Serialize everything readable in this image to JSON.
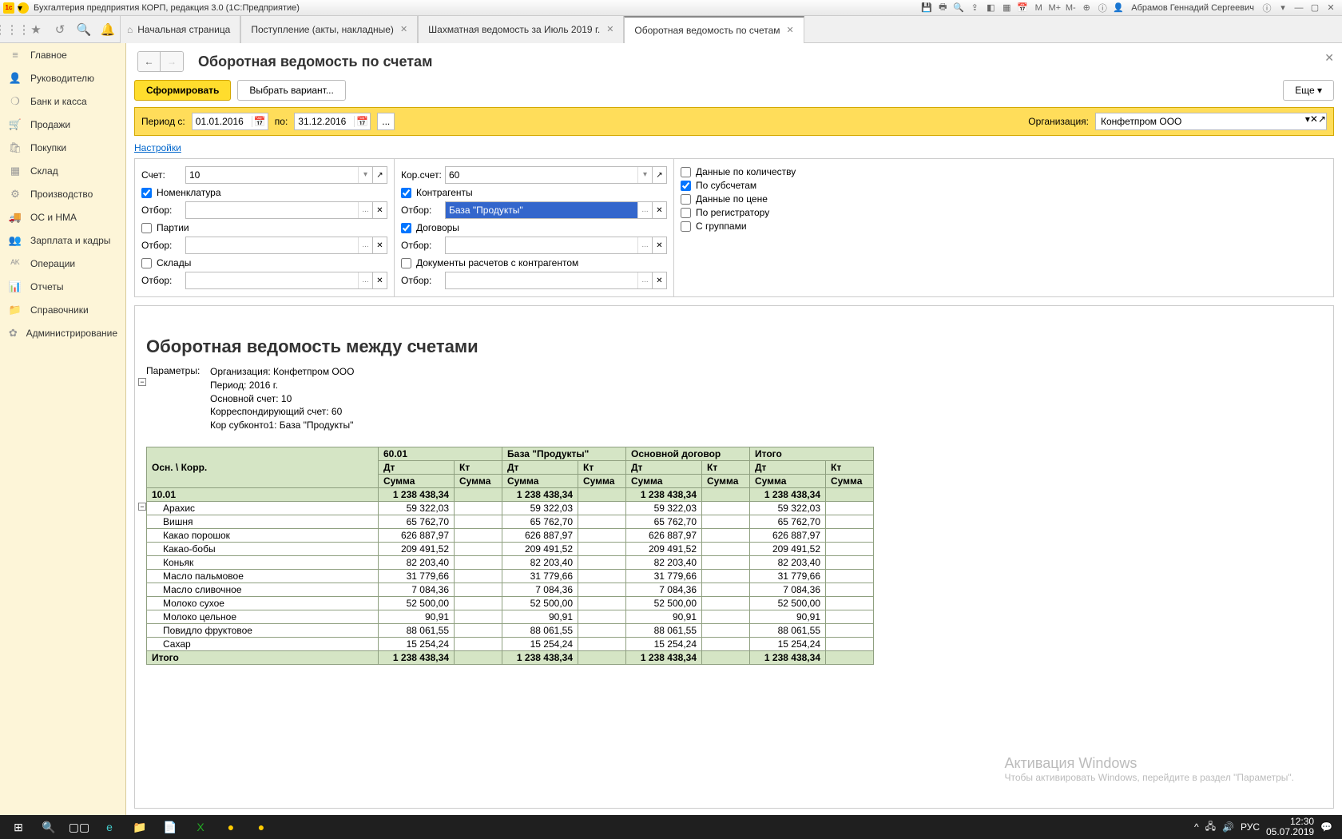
{
  "window": {
    "title": "Бухгалтерия предприятия КОРП, редакция 3.0  (1С:Предприятие)",
    "user": "Абрамов Геннадий Сергеевич"
  },
  "tabs": [
    {
      "label": "Начальная страница"
    },
    {
      "label": "Поступление (акты, накладные)"
    },
    {
      "label": "Шахматная ведомость за Июль 2019 г."
    },
    {
      "label": "Оборотная ведомость по счетам",
      "active": true
    }
  ],
  "sidebar": [
    {
      "icon": "≡",
      "label": "Главное"
    },
    {
      "icon": "👤",
      "label": "Руководителю"
    },
    {
      "icon": "❍",
      "label": "Банк и касса"
    },
    {
      "icon": "🛒",
      "label": "Продажи"
    },
    {
      "icon": "🛍",
      "label": "Покупки"
    },
    {
      "icon": "▦",
      "label": "Склад"
    },
    {
      "icon": "⚙",
      "label": "Производство"
    },
    {
      "icon": "🚚",
      "label": "ОС и НМА"
    },
    {
      "icon": "👥",
      "label": "Зарплата и кадры"
    },
    {
      "icon": "ᴬᴷ",
      "label": "Операции"
    },
    {
      "icon": "📊",
      "label": "Отчеты"
    },
    {
      "icon": "📁",
      "label": "Справочники"
    },
    {
      "icon": "✿",
      "label": "Администрирование"
    }
  ],
  "page": {
    "title": "Оборотная ведомость по счетам",
    "form_btn": "Сформировать",
    "variant_btn": "Выбрать вариант...",
    "more_btn": "Еще",
    "period_lbl": "Период с:",
    "period_from": "01.01.2016",
    "period_to_lbl": "по:",
    "period_to": "31.12.2016",
    "org_lbl": "Организация:",
    "org_val": "Конфетпром ООО",
    "settings_link": "Настройки"
  },
  "filters": {
    "left": {
      "account_lbl": "Счет:",
      "account_val": "10",
      "nomenclature": "Номенклатура",
      "otbor": "Отбор:",
      "parties": "Партии",
      "sklady": "Склады"
    },
    "right": {
      "cor_lbl": "Кор.счет:",
      "cor_val": "60",
      "contragents": "Контрагенты",
      "otbor": "Отбор:",
      "sel_val": "База \"Продукты\"",
      "dogovory": "Договоры",
      "docs": "Документы расчетов с контрагентом"
    },
    "options": {
      "qty": "Данные по количеству",
      "sub": "По субсчетам",
      "price": "Данные по цене",
      "reg": "По регистратору",
      "groups": "С группами"
    }
  },
  "report": {
    "title": "Оборотная ведомость между счетами",
    "params_lbl": "Параметры:",
    "params": [
      "Организация: Конфетпром ООО",
      "Период: 2016 г.",
      "Основной счет: 10",
      "Корреспондирующий счет: 60",
      "Кор субконто1: База \"Продукты\""
    ],
    "headers": {
      "corner": "Осн. \\ Корр.",
      "col1": "60.01",
      "col2": "База \"Продукты\"",
      "col3": "Основной договор",
      "col4": "Итого",
      "dt": "Дт",
      "kt": "Кт",
      "sum": "Сумма"
    },
    "group_row": {
      "label": "10.01",
      "val": "1 238 438,34"
    },
    "rows": [
      {
        "name": "Арахис",
        "val": "59 322,03"
      },
      {
        "name": "Вишня",
        "val": "65 762,70"
      },
      {
        "name": "Какао порошок",
        "val": "626 887,97"
      },
      {
        "name": "Какао-бобы",
        "val": "209 491,52"
      },
      {
        "name": "Коньяк",
        "val": "82 203,40"
      },
      {
        "name": "Масло пальмовое",
        "val": "31 779,66"
      },
      {
        "name": "Масло сливочное",
        "val": "7 084,36"
      },
      {
        "name": "Молоко сухое",
        "val": "52 500,00"
      },
      {
        "name": "Молоко цельное",
        "val": "90,91"
      },
      {
        "name": "Повидло фруктовое",
        "val": "88 061,55"
      },
      {
        "name": "Сахар",
        "val": "15 254,24"
      }
    ],
    "total_row": {
      "label": "Итого",
      "val": "1 238 438,34"
    }
  },
  "watermark": {
    "line1": "Активация Windows",
    "line2": "Чтобы активировать Windows, перейдите в раздел \"Параметры\"."
  },
  "taskbar": {
    "lang": "РУС",
    "time": "12:30",
    "date": "05.07.2019"
  },
  "chart_data": {
    "type": "table",
    "title": "Оборотная ведомость между счетами",
    "columns": [
      "Осн. \\ Корр.",
      "60.01 Дт Сумма",
      "60.01 Кт Сумма",
      "База \"Продукты\" Дт Сумма",
      "База \"Продукты\" Кт Сумма",
      "Основной договор Дт Сумма",
      "Основной договор Кт Сумма",
      "Итого Дт Сумма",
      "Итого Кт Сумма"
    ],
    "rows": [
      [
        "10.01",
        "1 238 438,34",
        "",
        "1 238 438,34",
        "",
        "1 238 438,34",
        "",
        "1 238 438,34",
        ""
      ],
      [
        "Арахис",
        "59 322,03",
        "",
        "59 322,03",
        "",
        "59 322,03",
        "",
        "59 322,03",
        ""
      ],
      [
        "Вишня",
        "65 762,70",
        "",
        "65 762,70",
        "",
        "65 762,70",
        "",
        "65 762,70",
        ""
      ],
      [
        "Какао порошок",
        "626 887,97",
        "",
        "626 887,97",
        "",
        "626 887,97",
        "",
        "626 887,97",
        ""
      ],
      [
        "Какао-бобы",
        "209 491,52",
        "",
        "209 491,52",
        "",
        "209 491,52",
        "",
        "209 491,52",
        ""
      ],
      [
        "Коньяк",
        "82 203,40",
        "",
        "82 203,40",
        "",
        "82 203,40",
        "",
        "82 203,40",
        ""
      ],
      [
        "Масло пальмовое",
        "31 779,66",
        "",
        "31 779,66",
        "",
        "31 779,66",
        "",
        "31 779,66",
        ""
      ],
      [
        "Масло сливочное",
        "7 084,36",
        "",
        "7 084,36",
        "",
        "7 084,36",
        "",
        "7 084,36",
        ""
      ],
      [
        "Молоко сухое",
        "52 500,00",
        "",
        "52 500,00",
        "",
        "52 500,00",
        "",
        "52 500,00",
        ""
      ],
      [
        "Молоко цельное",
        "90,91",
        "",
        "90,91",
        "",
        "90,91",
        "",
        "90,91",
        ""
      ],
      [
        "Повидло фруктовое",
        "88 061,55",
        "",
        "88 061,55",
        "",
        "88 061,55",
        "",
        "88 061,55",
        ""
      ],
      [
        "Сахар",
        "15 254,24",
        "",
        "15 254,24",
        "",
        "15 254,24",
        "",
        "15 254,24",
        ""
      ],
      [
        "Итого",
        "1 238 438,34",
        "",
        "1 238 438,34",
        "",
        "1 238 438,34",
        "",
        "1 238 438,34",
        ""
      ]
    ]
  }
}
